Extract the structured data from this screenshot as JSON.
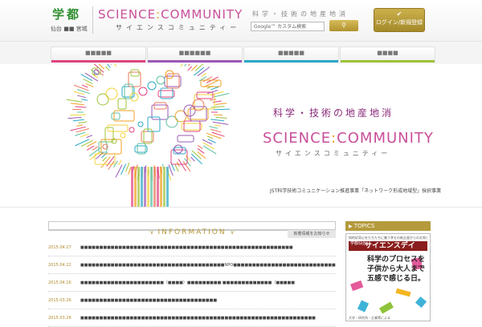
{
  "header": {
    "logo_char1": "学",
    "logo_char2": "都",
    "logo_sub": "仙台 ■■ 宮城",
    "brand_en_left": "SCIENCE",
    "brand_en_colon": ":",
    "brand_en_right": "COMMUNITY",
    "brand_ja": "サイエンスコミュニティー",
    "tagline": "科学・技術の地産地消",
    "search_placeholder": "Google™ カスタム検索",
    "login_label": "ログイン/新規登録",
    "accent_color": "#b49a3c"
  },
  "nav": {
    "items": [
      {
        "label": "■■■■■",
        "color": "#e0437f"
      },
      {
        "label": "■■■■■■",
        "color": "#9b59b6"
      },
      {
        "label": "■■■■■",
        "color": "#2aa8c7"
      },
      {
        "label": "■■■■",
        "color": "#9cc33a"
      },
      {
        "label": "■■■■■",
        "color": "#f0a020"
      }
    ]
  },
  "hero": {
    "title_ja": "科学・技術の地産地消",
    "title_en_left": "SCIENCE",
    "title_en_colon": ":",
    "title_en_right": "COMMUNITY",
    "title_kana": "サイエンスコミュニティー",
    "caption": "JST科学技術コミュニケーション推進事業「ネットワーク形成地域型」採択事業"
  },
  "information": {
    "heading": "INFORMATION",
    "more_label": "新着情報をお知らせ",
    "items": [
      {
        "date": "2015.04.27",
        "title": "■■■■■■■■■■■■■■■■■■■■■■■■■■■■■■■■■■■■■■■■■■■■■■■■■■■■■■■■"
      },
      {
        "date": "2015.04.22",
        "title": "■■■■■■■■■■■■■■■■■■■■■■■■■■■■■■■■■■■■■■NPO■■■■■■■■■■■■■■■■■■■■■■■■■■■"
      },
      {
        "date": "2015.04.16",
        "title": "■■■■■■■■■■■■■■■■■■■■■■（■■■■）■■■■■■■■■ ■■■■■■■■■■■■■（■■■■■"
      },
      {
        "date": "2015.03.26",
        "title": "■■■■■■■■■■■■■■■■■■■■■■■■■■■■■■■■■■■■"
      },
      {
        "date": "2015.03.26",
        "title": "■■■■■■■■■■■■■■■■■■■■■■■■■■■■■■■■■■■■■■■■■■■■■■■■■■■■■■■■■■■■■■"
      }
    ]
  },
  "topics": {
    "heading": "TOPICS",
    "card_top": "知的好奇心をたちたちに集う幸せの新企画からのお知らせ",
    "band_small": "学都仙台",
    "band_main": "サイエンスデイ",
    "lines": [
      "科学のプロセスを",
      "子供から大人まで",
      "五感で感じる日。"
    ],
    "card_bottom": "大学・研究所・企業等による"
  }
}
